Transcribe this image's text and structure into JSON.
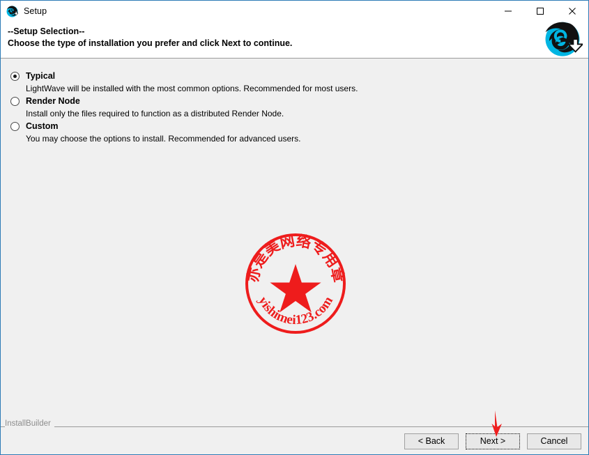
{
  "window": {
    "title": "Setup",
    "icon": "lightwave-spiral-icon",
    "border_color": "#2c7bb6",
    "controls": {
      "minimize": "minimize-icon",
      "maximize": "maximize-icon",
      "close": "close-icon"
    }
  },
  "header": {
    "line1": "--Setup Selection--",
    "line2": "Choose the type of installation you prefer and click Next to continue.",
    "logo": "lightwave-logo"
  },
  "options": [
    {
      "label": "Typical",
      "description": "LightWave will be installed with the most common options. Recommended for most users.",
      "selected": true
    },
    {
      "label": "Render Node",
      "description": "Install only the files required to function as a distributed Render Node.",
      "selected": false
    },
    {
      "label": "Custom",
      "description": "You may choose the options to install. Recommended for advanced users.",
      "selected": false
    }
  ],
  "watermark": {
    "top_text": "亦是美网络专用章",
    "bottom_text": "yishimei123.com",
    "color": "#ee1c1c",
    "shape": "circular-stamp-with-star"
  },
  "footer": {
    "brand": "InstallBuilder",
    "buttons": [
      {
        "label": "< Back",
        "focused": false
      },
      {
        "label": "Next >",
        "focused": true
      },
      {
        "label": "Cancel",
        "focused": false
      }
    ]
  },
  "annotation": {
    "arrow": "red-down-arrow",
    "color": "#ee2020",
    "points_to": "Next >"
  }
}
